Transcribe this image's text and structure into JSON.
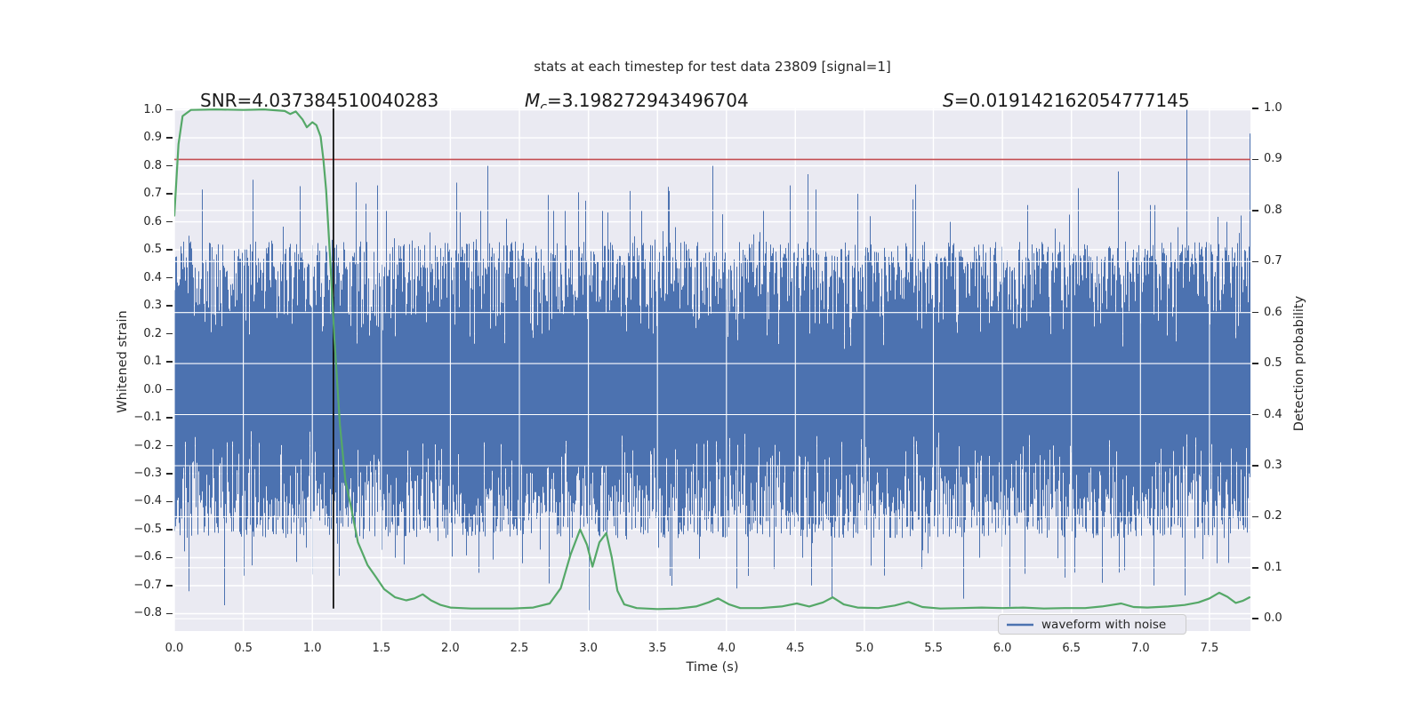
{
  "title": "stats at each timestep for test data 23809 [signal=1]",
  "annotations": {
    "snr": {
      "text": "SNR=4.037384510040283"
    },
    "chirp_mass": {
      "symbol": "M",
      "subscript": "c",
      "rest": "=3.198272943496704"
    },
    "significance": {
      "symbol": "S",
      "rest": "=0.019142162054777145"
    }
  },
  "axes": {
    "x": {
      "label": "Time (s)",
      "tick_labels": [
        "0.0",
        "0.5",
        "1.0",
        "1.5",
        "2.0",
        "2.5",
        "3.0",
        "3.5",
        "4.0",
        "4.5",
        "5.0",
        "5.5",
        "6.0",
        "6.5",
        "7.0",
        "7.5"
      ],
      "tick_values": [
        0,
        0.5,
        1,
        1.5,
        2,
        2.5,
        3,
        3.5,
        4,
        4.5,
        5,
        5.5,
        6,
        6.5,
        7,
        7.5
      ]
    },
    "left": {
      "label": "Whitened strain",
      "tick_labels": [
        "1.0",
        "0.9",
        "0.8",
        "0.7",
        "0.6",
        "0.5",
        "0.4",
        "0.3",
        "0.2",
        "0.1",
        "0.0",
        "−0.1",
        "−0.2",
        "−0.3",
        "−0.4",
        "−0.5",
        "−0.6",
        "−0.7",
        "−0.8"
      ],
      "tick_values": [
        1,
        0.9,
        0.8,
        0.7,
        0.6,
        0.5,
        0.4,
        0.3,
        0.2,
        0.1,
        0,
        -0.1,
        -0.2,
        -0.3,
        -0.4,
        -0.5,
        -0.6,
        -0.7,
        -0.8
      ]
    },
    "right": {
      "label": "Detection probability",
      "tick_labels": [
        "1.0",
        "0.9",
        "0.8",
        "0.7",
        "0.6",
        "0.5",
        "0.4",
        "0.3",
        "0.2",
        "0.1",
        "0.0"
      ],
      "tick_values": [
        1,
        0.9,
        0.8,
        0.7,
        0.6,
        0.5,
        0.4,
        0.3,
        0.2,
        0.1,
        0
      ]
    }
  },
  "legend": {
    "items": [
      {
        "label": "waveform with noise",
        "color": "#4c72b0"
      }
    ]
  },
  "colors": {
    "waveform": "#4c72b0",
    "probability_line": "#55a868",
    "threshold_line": "#c44e52",
    "marker_line": "#111111",
    "axes_background": "#eaeaf2",
    "grid": "#ffffff",
    "text": "#262626",
    "legend_border": "#cccccc"
  },
  "chart_data": {
    "type": "line",
    "title": "stats at each timestep for test data 23809 [signal=1]",
    "xlabel": "Time (s)",
    "ylabel_left": "Whitened strain",
    "ylabel_right": "Detection probability",
    "xlim": [
      0,
      7.797
    ],
    "ylim_left": [
      -0.862,
      1.005
    ],
    "ylim_right": [
      -0.024,
      1.0
    ],
    "grid": true,
    "legend_position": "lower right",
    "threshold_probability": 0.9,
    "marker_time": 1.153,
    "marker_ymin_probability": 0.02,
    "detection_probability": {
      "points": [
        [
          0.0,
          0.79
        ],
        [
          0.03,
          0.93
        ],
        [
          0.06,
          0.985
        ],
        [
          0.12,
          0.997
        ],
        [
          0.3,
          0.998
        ],
        [
          0.5,
          0.997
        ],
        [
          0.65,
          0.998
        ],
        [
          0.8,
          0.995
        ],
        [
          0.84,
          0.989
        ],
        [
          0.88,
          0.994
        ],
        [
          0.93,
          0.978
        ],
        [
          0.96,
          0.963
        ],
        [
          1.0,
          0.973
        ],
        [
          1.03,
          0.967
        ],
        [
          1.06,
          0.945
        ],
        [
          1.08,
          0.9
        ],
        [
          1.1,
          0.84
        ],
        [
          1.13,
          0.7
        ],
        [
          1.16,
          0.55
        ],
        [
          1.2,
          0.38
        ],
        [
          1.24,
          0.27
        ],
        [
          1.28,
          0.22
        ],
        [
          1.33,
          0.15
        ],
        [
          1.4,
          0.105
        ],
        [
          1.46,
          0.082
        ],
        [
          1.52,
          0.058
        ],
        [
          1.6,
          0.042
        ],
        [
          1.68,
          0.036
        ],
        [
          1.74,
          0.04
        ],
        [
          1.8,
          0.048
        ],
        [
          1.86,
          0.036
        ],
        [
          1.93,
          0.027
        ],
        [
          2.0,
          0.022
        ],
        [
          2.15,
          0.02
        ],
        [
          2.3,
          0.02
        ],
        [
          2.45,
          0.02
        ],
        [
          2.6,
          0.022
        ],
        [
          2.72,
          0.03
        ],
        [
          2.8,
          0.06
        ],
        [
          2.87,
          0.125
        ],
        [
          2.94,
          0.175
        ],
        [
          2.99,
          0.145
        ],
        [
          3.03,
          0.102
        ],
        [
          3.08,
          0.15
        ],
        [
          3.13,
          0.168
        ],
        [
          3.17,
          0.12
        ],
        [
          3.21,
          0.055
        ],
        [
          3.26,
          0.028
        ],
        [
          3.35,
          0.021
        ],
        [
          3.5,
          0.019
        ],
        [
          3.65,
          0.02
        ],
        [
          3.78,
          0.024
        ],
        [
          3.87,
          0.032
        ],
        [
          3.94,
          0.04
        ],
        [
          4.02,
          0.028
        ],
        [
          4.1,
          0.021
        ],
        [
          4.25,
          0.021
        ],
        [
          4.4,
          0.024
        ],
        [
          4.51,
          0.03
        ],
        [
          4.6,
          0.024
        ],
        [
          4.7,
          0.032
        ],
        [
          4.77,
          0.042
        ],
        [
          4.85,
          0.028
        ],
        [
          4.95,
          0.022
        ],
        [
          5.1,
          0.021
        ],
        [
          5.22,
          0.026
        ],
        [
          5.32,
          0.033
        ],
        [
          5.42,
          0.023
        ],
        [
          5.55,
          0.02
        ],
        [
          5.7,
          0.021
        ],
        [
          5.85,
          0.022
        ],
        [
          6.0,
          0.021
        ],
        [
          6.15,
          0.022
        ],
        [
          6.3,
          0.02
        ],
        [
          6.45,
          0.021
        ],
        [
          6.6,
          0.021
        ],
        [
          6.72,
          0.024
        ],
        [
          6.86,
          0.03
        ],
        [
          6.95,
          0.023
        ],
        [
          7.05,
          0.022
        ],
        [
          7.2,
          0.024
        ],
        [
          7.32,
          0.027
        ],
        [
          7.42,
          0.032
        ],
        [
          7.5,
          0.04
        ],
        [
          7.57,
          0.051
        ],
        [
          7.63,
          0.043
        ],
        [
          7.69,
          0.031
        ],
        [
          7.74,
          0.035
        ],
        [
          7.79,
          0.042
        ]
      ]
    },
    "waveform_noise": {
      "description": "dense zero-mean noise rendered as per-pixel min/max envelope bars",
      "seed": 20230809,
      "base_amplitude": 0.13,
      "spread": 0.4,
      "shape_power": 0.45,
      "tail_probability": 0.06,
      "tail_scale": 0.28,
      "spikes_positive": [
        [
          0.1,
          0.55
        ],
        [
          0.57,
          0.75
        ],
        [
          1.47,
          0.73
        ],
        [
          1.7,
          0.52
        ],
        [
          2.04,
          0.74
        ],
        [
          2.27,
          0.8
        ],
        [
          2.83,
          0.64
        ],
        [
          3.1,
          0.64
        ],
        [
          3.3,
          0.71
        ],
        [
          3.58,
          0.71
        ],
        [
          3.9,
          0.8
        ],
        [
          4.46,
          0.73
        ],
        [
          4.59,
          0.77
        ],
        [
          4.95,
          0.7
        ],
        [
          5.35,
          0.68
        ],
        [
          5.62,
          0.6
        ],
        [
          6.18,
          0.66
        ],
        [
          6.55,
          0.72
        ],
        [
          6.84,
          0.78
        ],
        [
          7.1,
          0.66
        ],
        [
          7.33,
          1.0
        ],
        [
          7.62,
          0.6
        ],
        [
          7.8,
          0.915
        ]
      ],
      "spikes_negative": [
        [
          0.1,
          -0.72
        ],
        [
          0.36,
          -0.77
        ],
        [
          1.0,
          -0.66
        ],
        [
          1.19,
          -0.66
        ],
        [
          1.6,
          -0.6
        ],
        [
          2.52,
          -0.62
        ],
        [
          2.86,
          -0.6
        ],
        [
          3.6,
          -0.7
        ],
        [
          4.34,
          -0.64
        ],
        [
          4.55,
          -0.6
        ],
        [
          5.41,
          -0.64
        ],
        [
          5.83,
          -0.6
        ],
        [
          6.05,
          -0.775
        ],
        [
          6.4,
          -0.58
        ],
        [
          6.72,
          -0.69
        ],
        [
          7.32,
          -0.735
        ],
        [
          7.55,
          -0.62
        ]
      ]
    }
  }
}
